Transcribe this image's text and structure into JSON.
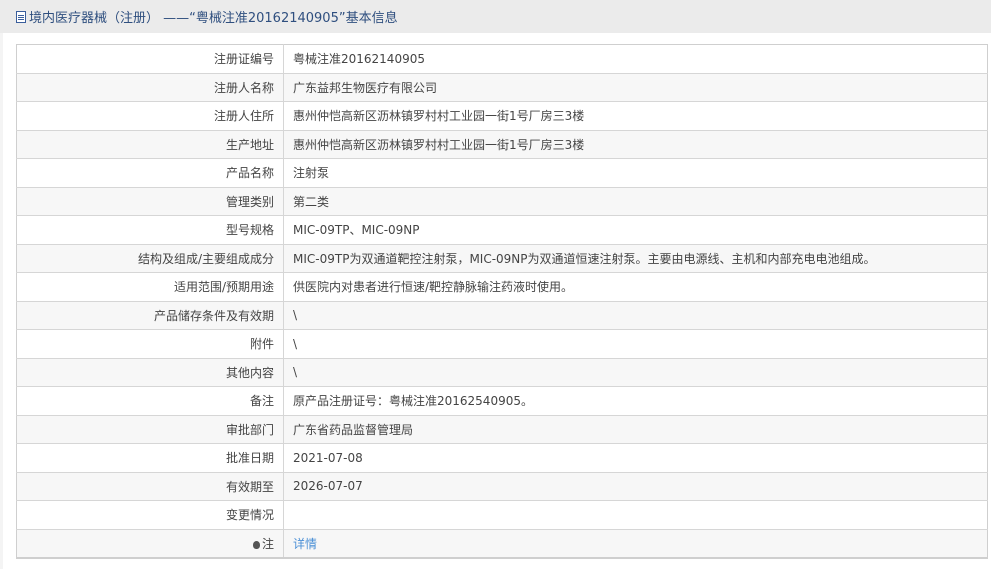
{
  "header": {
    "title": "境内医疗器械（注册） ——“粤械注准20162140905”基本信息"
  },
  "rows": [
    {
      "label": "注册证编号",
      "value": "粤械注准20162140905"
    },
    {
      "label": "注册人名称",
      "value": "广东益邦生物医疗有限公司"
    },
    {
      "label": "注册人住所",
      "value": "惠州仲恺高新区沥林镇罗村村工业园一街1号厂房三3楼"
    },
    {
      "label": "生产地址",
      "value": "惠州仲恺高新区沥林镇罗村村工业园一街1号厂房三3楼"
    },
    {
      "label": "产品名称",
      "value": "注射泵"
    },
    {
      "label": "管理类别",
      "value": "第二类"
    },
    {
      "label": "型号规格",
      "value": "MIC-09TP、MIC-09NP"
    },
    {
      "label": "结构及组成/主要组成成分",
      "value": "MIC-09TP为双通道靶控注射泵，MIC-09NP为双通道恒速注射泵。主要由电源线、主机和内部充电电池组成。"
    },
    {
      "label": "适用范围/预期用途",
      "value": "供医院内对患者进行恒速/靶控静脉输注药液时使用。"
    },
    {
      "label": "产品储存条件及有效期",
      "value": "\\"
    },
    {
      "label": "附件",
      "value": "\\"
    },
    {
      "label": "其他内容",
      "value": "\\"
    },
    {
      "label": "备注",
      "value": "原产品注册证号：粤械注准20162540905。"
    },
    {
      "label": "审批部门",
      "value": "广东省药品监督管理局"
    },
    {
      "label": "批准日期",
      "value": "2021-07-08"
    },
    {
      "label": "有效期至",
      "value": "2026-07-07"
    },
    {
      "label": "变更情况",
      "value": ""
    }
  ],
  "note": {
    "label": "注",
    "link": "详情",
    "icon": "lightbulb-icon"
  }
}
